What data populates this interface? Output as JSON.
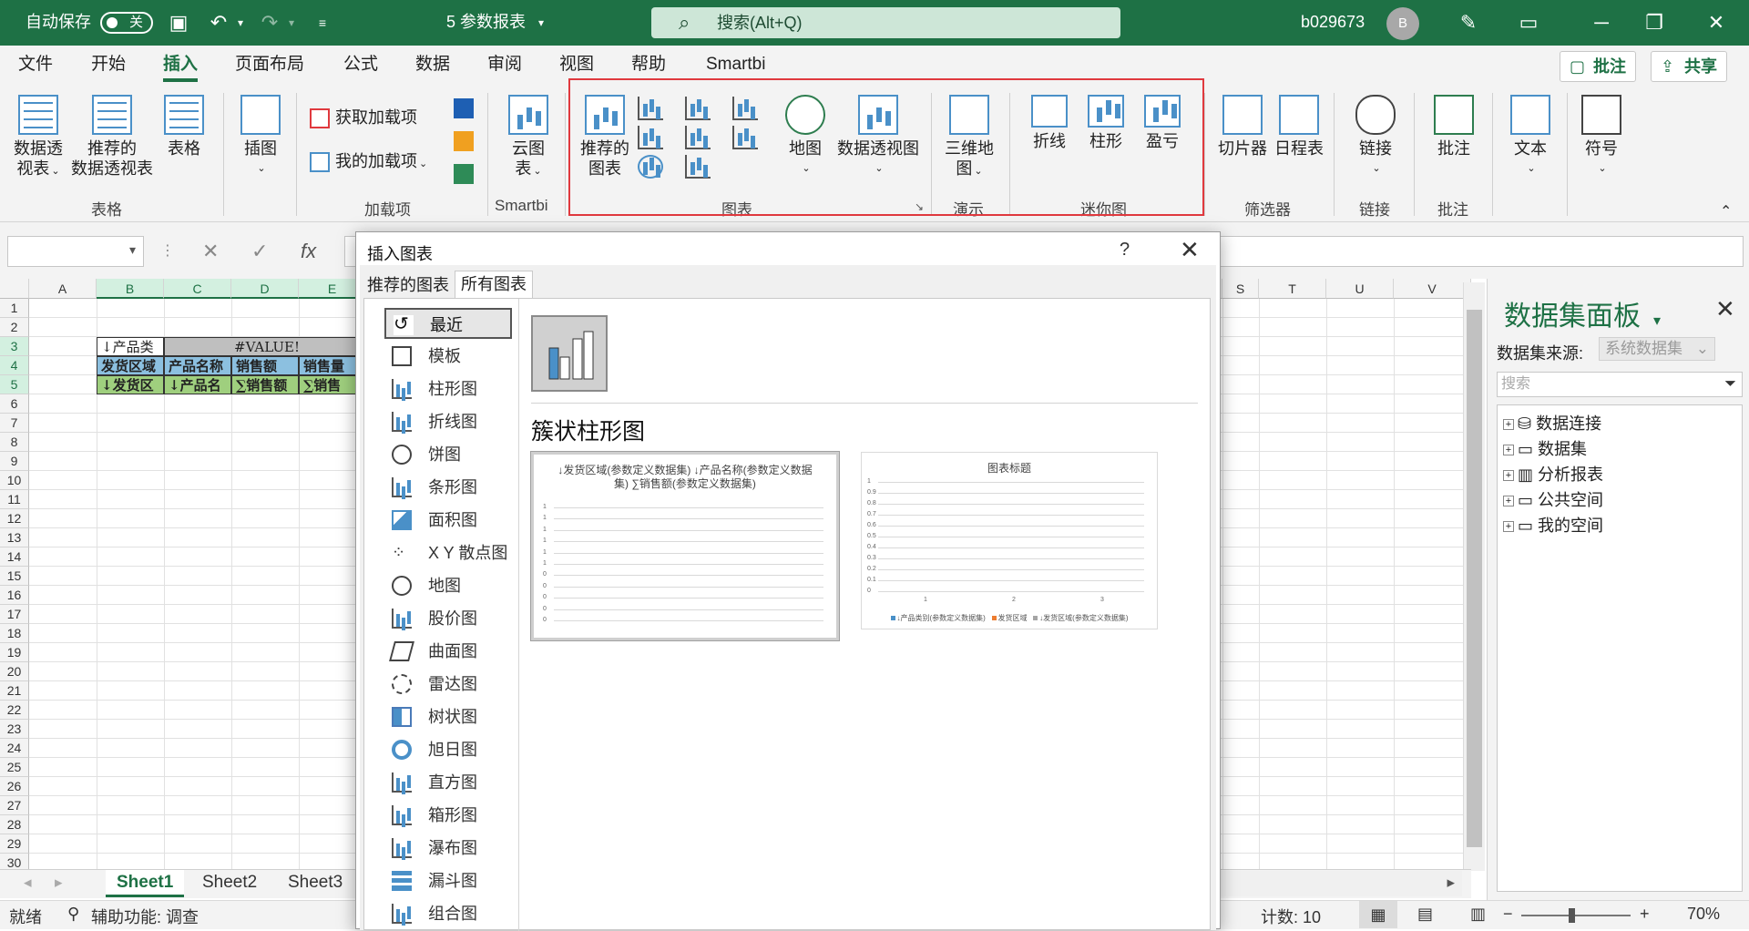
{
  "titlebar": {
    "autosave_label": "自动保存",
    "autosave_state": "关",
    "doc_title": "5 参数报表",
    "search_placeholder": "搜索(Alt+Q)",
    "user_name": "b029673",
    "avatar_initial": "B"
  },
  "menu": {
    "tabs": [
      "文件",
      "开始",
      "插入",
      "页面布局",
      "公式",
      "数据",
      "审阅",
      "视图",
      "帮助",
      "Smartbi"
    ],
    "active": "插入",
    "comment_label": "批注",
    "share_label": "共享"
  },
  "ribbon": {
    "tables": {
      "pivot_line1": "数据透",
      "pivot_line2": "视表",
      "recommended_line1": "推荐的",
      "recommended_line2": "数据透视表",
      "table": "表格",
      "group": "表格"
    },
    "illustrations": {
      "label": "插图"
    },
    "addins": {
      "get": "获取加载项",
      "mine": "我的加载项",
      "group": "加载项"
    },
    "smartbi": {
      "cloud_line1": "云图",
      "cloud_line2": "表",
      "group": "Smartbi"
    },
    "charts": {
      "recommended_line1": "推荐的",
      "recommended_line2": "图表",
      "map": "地图",
      "pivot_chart": "数据透视图",
      "group": "图表"
    },
    "tours": {
      "line1": "三维地",
      "line2": "图",
      "group": "演示"
    },
    "sparklines": {
      "line": "折线",
      "column": "柱形",
      "winloss": "盈亏",
      "group": "迷你图"
    },
    "filters": {
      "slicer": "切片器",
      "timeline": "日程表",
      "group": "筛选器"
    },
    "links": {
      "link": "链接",
      "group": "链接"
    },
    "comments": {
      "comment": "批注",
      "group": "批注"
    },
    "text": {
      "label": "文本"
    },
    "symbols": {
      "label": "符号"
    }
  },
  "sheet": {
    "columns_left": [
      "A",
      "B",
      "C",
      "D",
      "E"
    ],
    "columns_right": [
      "S",
      "T",
      "U",
      "V"
    ],
    "rows": [
      "1",
      "2",
      "3",
      "4",
      "5",
      "6",
      "7",
      "8",
      "9",
      "10",
      "11",
      "12",
      "13",
      "14",
      "15",
      "16",
      "17",
      "18",
      "19",
      "20",
      "21",
      "22",
      "23",
      "24",
      "25",
      "26",
      "27",
      "28",
      "29",
      "30"
    ],
    "cells": {
      "b3": "↓产品类",
      "c3": "#VALUE!",
      "b4": "发货区域",
      "c4": "产品名称",
      "d4": "销售额",
      "e4": "销售量",
      "b5": "↓发货区",
      "c5": "↓产品名",
      "d5": "∑销售额",
      "e5": "∑销售"
    },
    "tabs": [
      "Sheet1",
      "Sheet2",
      "Sheet3"
    ],
    "active_tab": "Sheet1"
  },
  "status": {
    "mode": "就绪",
    "accessibility": "辅助功能: 调查",
    "count": "计数: 10",
    "zoom": "70%"
  },
  "dialog": {
    "title": "插入图表",
    "tabs": [
      "推荐的图表",
      "所有图表"
    ],
    "active_tab": "所有图表",
    "categories": [
      "最近",
      "模板",
      "柱形图",
      "折线图",
      "饼图",
      "条形图",
      "面积图",
      "X Y 散点图",
      "地图",
      "股价图",
      "曲面图",
      "雷达图",
      "树状图",
      "旭日图",
      "直方图",
      "箱形图",
      "瀑布图",
      "漏斗图",
      "组合图"
    ],
    "selected_category": "最近",
    "chart_type_name": "簇状柱形图",
    "preview1": {
      "title": "↓发货区域(参数定义数据集) ↓产品名称(参数定义数据集) ∑销售额(参数定义数据集)",
      "y_ticks": [
        "1",
        "1",
        "1",
        "1",
        "1",
        "1",
        "0",
        "0",
        "0",
        "0",
        "0"
      ]
    },
    "preview2": {
      "title": "图表标题",
      "y_ticks": [
        "1",
        "0.9",
        "0.8",
        "0.7",
        "0.6",
        "0.5",
        "0.4",
        "0.3",
        "0.2",
        "0.1",
        "0"
      ],
      "x_ticks": [
        "1",
        "2",
        "3"
      ],
      "legend": [
        "↓产品类别(参数定义数据集)",
        "发货区域",
        "↓发货区域(参数定义数据集)"
      ],
      "legend_colors": [
        "#4a90c8",
        "#ed7d31",
        "#a5a5a5"
      ]
    }
  },
  "panel": {
    "title": "数据集面板",
    "source_label": "数据集来源:",
    "source_value": "系统数据集",
    "search_placeholder": "搜索",
    "tree": [
      "数据连接",
      "数据集",
      "分析报表",
      "公共空间",
      "我的空间"
    ]
  },
  "colors": {
    "accent": "#1e7145",
    "highlight": "#e0393e",
    "cell_header_fill": "#8cc0e0",
    "cell_data_fill": "#9fcf7e"
  }
}
